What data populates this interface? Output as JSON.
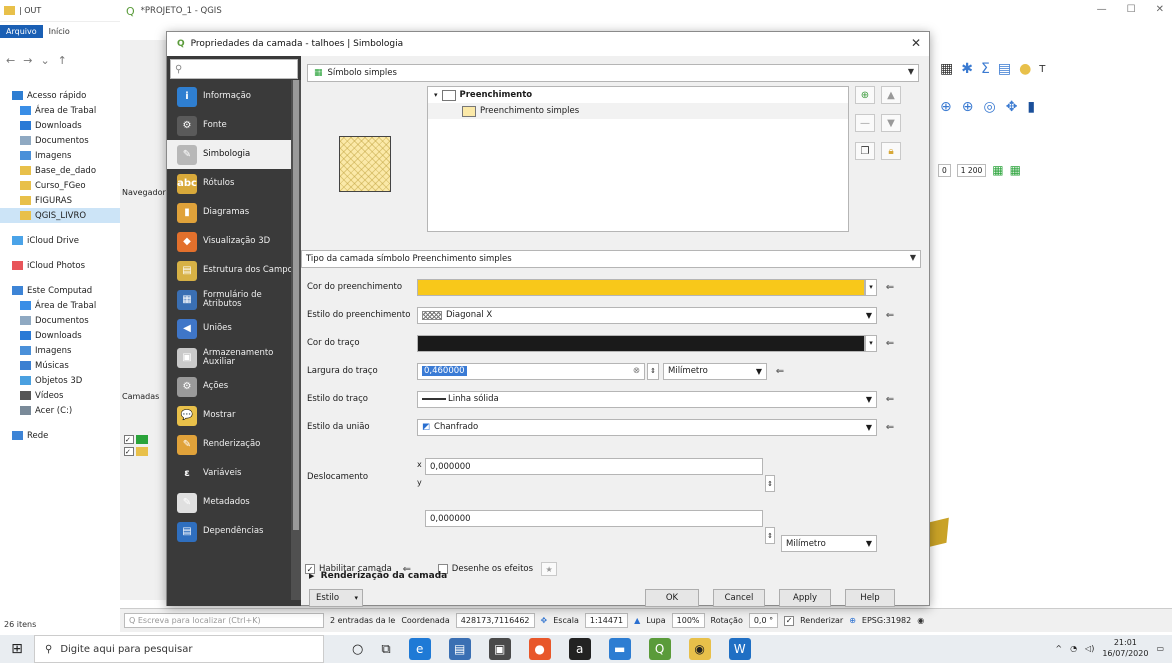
{
  "explorer": {
    "title": "| OUT",
    "ribbon": {
      "file": "Arquivo",
      "home": "Início"
    },
    "sidebar": [
      {
        "label": "Acesso rápido",
        "color": "#2d7dd2",
        "indent": false
      },
      {
        "label": "Área de Trabal",
        "color": "#3a8ee6",
        "indent": true
      },
      {
        "label": "Downloads",
        "color": "#2a7ad6",
        "indent": true
      },
      {
        "label": "Documentos",
        "color": "#8fa9c2",
        "indent": true
      },
      {
        "label": "Imagens",
        "color": "#4a90d9",
        "indent": true
      },
      {
        "label": "Base_de_dado",
        "color": "#e8c04a",
        "indent": true
      },
      {
        "label": "Curso_FGeo",
        "color": "#e8c04a",
        "indent": true
      },
      {
        "label": "FIGURAS",
        "color": "#e8c04a",
        "indent": true
      },
      {
        "label": "QGIS_LIVRO",
        "color": "#e8c04a",
        "indent": true,
        "selected": true
      },
      {
        "label": "iCloud Drive",
        "color": "#4aa3e8",
        "indent": false,
        "gap": true
      },
      {
        "label": "iCloud Photos",
        "color": "#e8555a",
        "indent": false,
        "gap": true
      },
      {
        "label": "Este Computad",
        "color": "#3d84d6",
        "indent": false,
        "gap": true
      },
      {
        "label": "Área de Trabal",
        "color": "#3a8ee6",
        "indent": true
      },
      {
        "label": "Documentos",
        "color": "#8fa9c2",
        "indent": true
      },
      {
        "label": "Downloads",
        "color": "#2a7ad6",
        "indent": true
      },
      {
        "label": "Imagens",
        "color": "#4a90d9",
        "indent": true
      },
      {
        "label": "Músicas",
        "color": "#3b7fd1",
        "indent": true
      },
      {
        "label": "Objetos 3D",
        "color": "#4aa0e0",
        "indent": true
      },
      {
        "label": "Vídeos",
        "color": "#555555",
        "indent": true
      },
      {
        "label": "Acer (C:)",
        "color": "#7a8a99",
        "indent": true
      },
      {
        "label": "Rede",
        "color": "#3d84d6",
        "indent": false,
        "gap": true
      }
    ],
    "status": "26 itens"
  },
  "qgis": {
    "title": "*PROJETO_1 - QGIS",
    "left_labels": {
      "navegador": "Navegador",
      "camadas": "Camadas"
    },
    "scale_field": "1 200",
    "status": {
      "search_placeholder": "Q  Escreva para localizar (Ctrl+K)",
      "selected_info": "2 entradas da le",
      "coord_label": "Coordenada",
      "coord_value": "428173,7116462",
      "scale_label": "Escala",
      "scale_value": "1:14471",
      "magnifier_label": "Lupa",
      "magnifier_value": "100%",
      "rotation_label": "Rotação",
      "rotation_value": "0,0 °",
      "render_label": "Renderizar",
      "crs": "EPSG:31982"
    }
  },
  "dialog": {
    "title": "Propriedades da camada - talhoes | Simbologia",
    "search_icon": "search-icon",
    "nav_items": [
      {
        "label": "Informação",
        "icon_color": "#2f7fd1",
        "glyph": "i"
      },
      {
        "label": "Fonte",
        "icon_color": "#5a5a5a",
        "glyph": "⚙"
      },
      {
        "label": "Simbologia",
        "icon_color": "#b8b8b8",
        "glyph": "✎",
        "active": true
      },
      {
        "label": "Rótulos",
        "icon_color": "#d8a93a",
        "glyph": "abc"
      },
      {
        "label": "Diagramas",
        "icon_color": "#e0a23a",
        "glyph": "▮"
      },
      {
        "label": "Visualização 3D",
        "icon_color": "#e3702c",
        "glyph": "◆"
      },
      {
        "label": "Estrutura dos Campos",
        "icon_color": "#d7b145",
        "glyph": "▤"
      },
      {
        "label": "Formulário de Atributos",
        "icon_color": "#3a6fb3",
        "glyph": "▦"
      },
      {
        "label": "Uniões",
        "icon_color": "#3f76c8",
        "glyph": "◀"
      },
      {
        "label": "Armazenamento Auxiliar",
        "icon_color": "#c9c9c9",
        "glyph": "▣"
      },
      {
        "label": "Ações",
        "icon_color": "#9a9a9a",
        "glyph": "⚙"
      },
      {
        "label": "Mostrar",
        "icon_color": "#e8c04a",
        "glyph": "💬"
      },
      {
        "label": "Renderização",
        "icon_color": "#e0a23a",
        "glyph": "✎"
      },
      {
        "label": "Variáveis",
        "icon_color": "#3a3a3a",
        "glyph": "ε"
      },
      {
        "label": "Metadados",
        "icon_color": "#e0e0e0",
        "glyph": "✎"
      },
      {
        "label": "Dependências",
        "icon_color": "#2f6fbf",
        "glyph": "▤"
      }
    ],
    "symbol_type": "Símbolo simples",
    "tree": {
      "root": "Preenchimento",
      "child": "Preenchimento simples"
    },
    "layer_type_label": "Tipo da camada símbolo",
    "layer_type_value": "Preenchimento simples",
    "fields": {
      "fill_color_label": "Cor do preenchimento",
      "fill_color": "#f8c81a",
      "fill_style_label": "Estilo do preenchimento",
      "fill_style_value": "Diagonal X",
      "stroke_color_label": "Cor do traço",
      "stroke_color": "#1a1a1a",
      "stroke_width_label": "Largura do traço",
      "stroke_width_value": "0,460000",
      "stroke_width_unit": "Milímetro",
      "stroke_style_label": "Estilo do traço",
      "stroke_style_value": "Linha sólida",
      "join_style_label": "Estilo da união",
      "join_style_value": "Chanfrado",
      "offset_label": "Deslocamento",
      "offset_x_label": "x",
      "offset_x": "0,000000",
      "offset_y_label": "y",
      "offset_y": "0,000000",
      "offset_unit": "Milímetro"
    },
    "enable_layer_label": "Habilitar camada",
    "enable_layer_checked": true,
    "draw_effects_label": "Desenhe os efeitos",
    "render_section": "Renderização da camada",
    "buttons": {
      "style": "Estilo",
      "ok": "OK",
      "cancel": "Cancel",
      "apply": "Apply",
      "help": "Help"
    }
  },
  "taskbar": {
    "search_placeholder": "Digite aqui para pesquisar",
    "time": "21:01",
    "date": "16/07/2020"
  }
}
